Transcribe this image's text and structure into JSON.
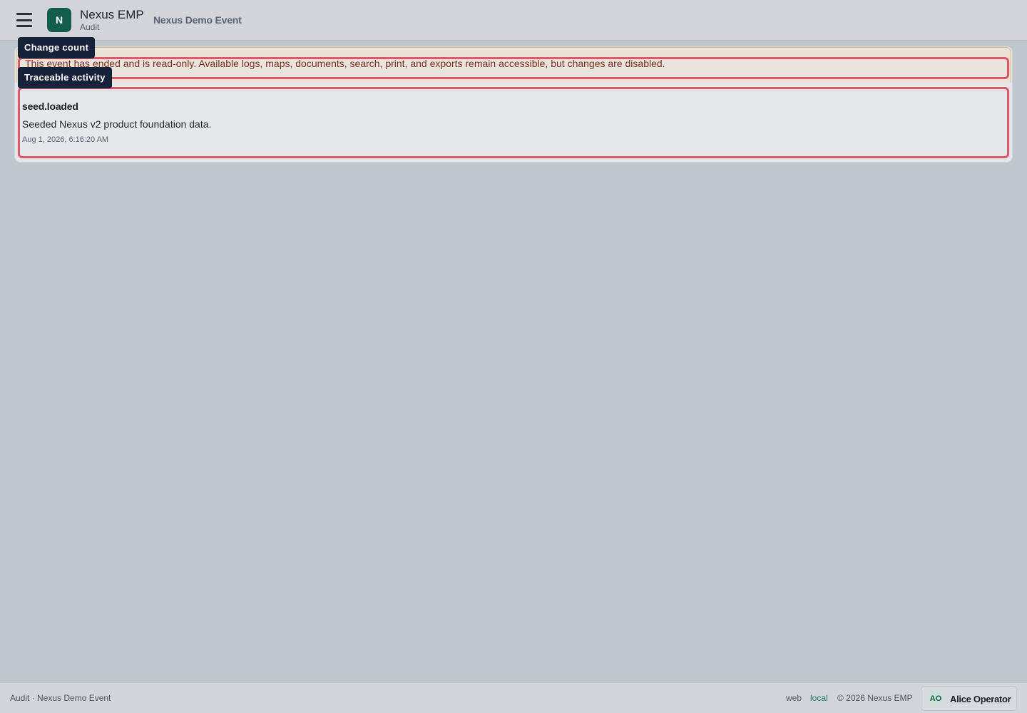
{
  "header": {
    "menu_icon": "hamburger-icon",
    "logo_letter": "N",
    "brand_title": "Nexus EMP",
    "brand_subtitle": "Audit",
    "event_name": "Nexus Demo Event"
  },
  "banner": {
    "text": "This event has ended and is read-only. Available logs, maps, documents, search, print, and exports remain accessible, but changes are disabled."
  },
  "tooltips": {
    "change_count": "Change count",
    "traceable_activity": "Traceable activity"
  },
  "activity": {
    "name": "seed.loaded",
    "description": "Seeded Nexus v2 product foundation data.",
    "timestamp": "Aug 1, 2026, 6:16:20 AM"
  },
  "footer": {
    "left_text": "Audit · Nexus Demo Event",
    "web": "web",
    "local": "local",
    "copyright": "© 2026 Nexus EMP",
    "user_initials": "AO",
    "user_name": "Alice Operator"
  },
  "colors": {
    "brand": "#145c4e",
    "highlight": "#e0576c",
    "tooltip_bg": "#16223a"
  }
}
